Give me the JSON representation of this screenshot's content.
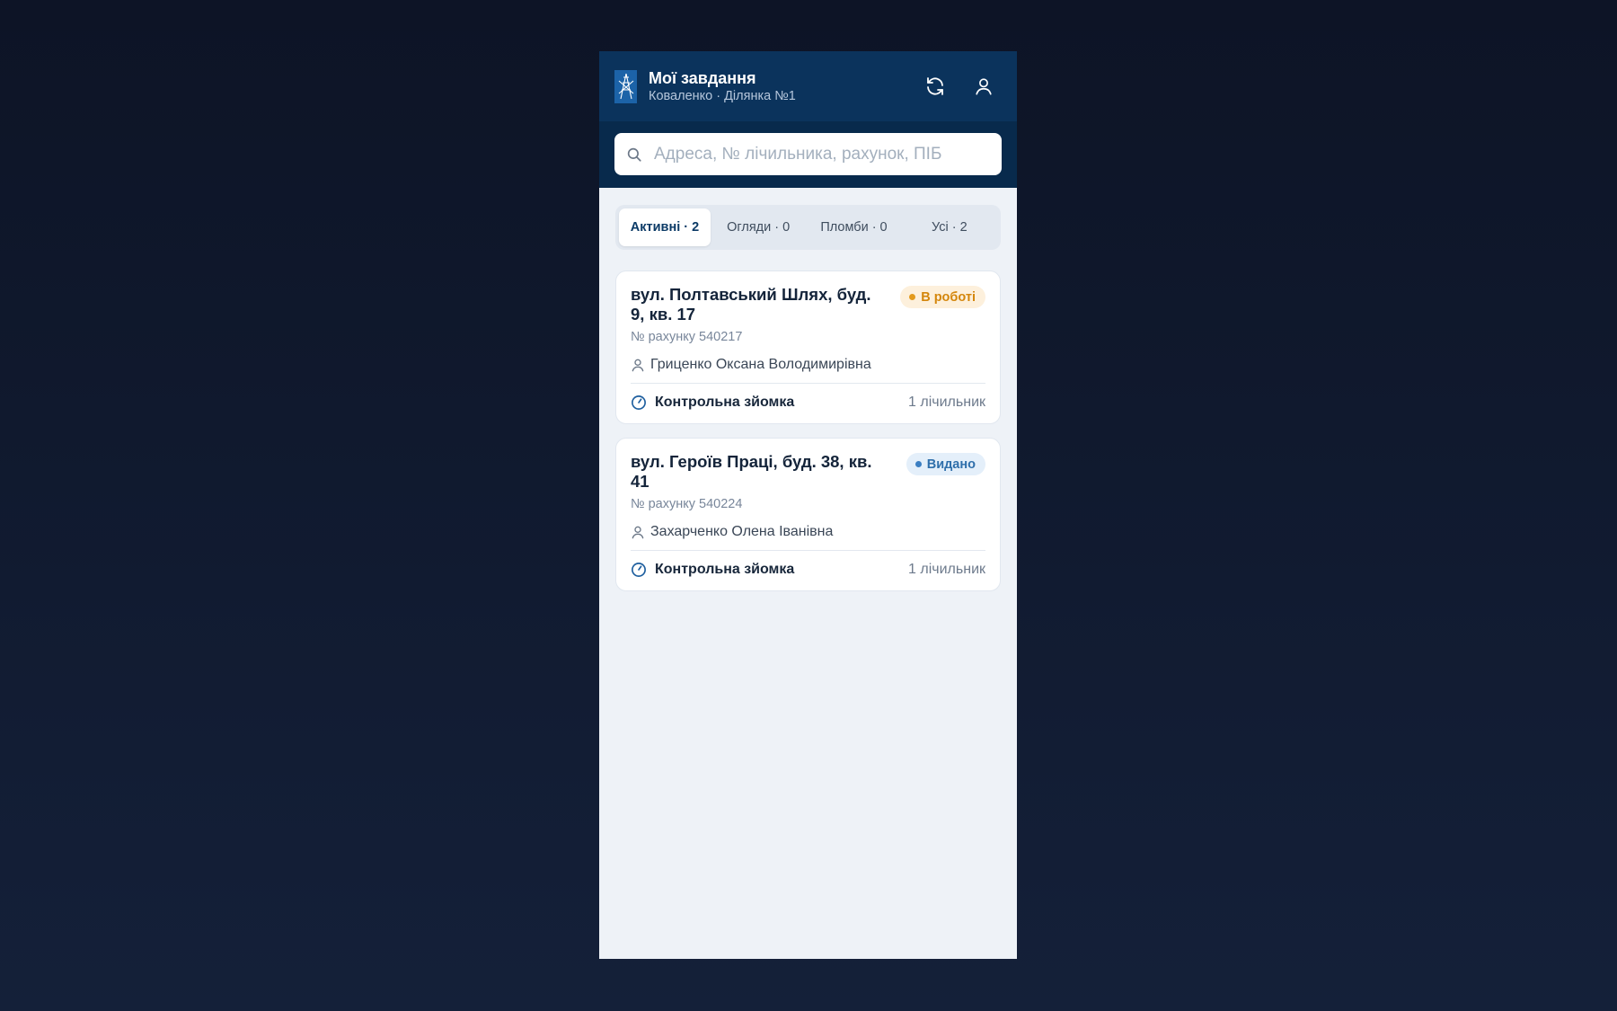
{
  "header": {
    "title": "Мої завдання",
    "subtitle": "Коваленко · Ділянка №1"
  },
  "search": {
    "placeholder": "Адреса, № лічильника, рахунок, ПІБ",
    "value": ""
  },
  "tabs": [
    {
      "label": "Активні · 2",
      "active": true
    },
    {
      "label": "Огляди · 0",
      "active": false
    },
    {
      "label": "Пломби · 0",
      "active": false
    },
    {
      "label": "Усі · 2",
      "active": false
    }
  ],
  "tasks": [
    {
      "address": "вул. Полтавський Шлях, буд. 9, кв. 17",
      "status": "В роботі",
      "status_color": "#d4860b",
      "account": "№ рахунку 540217",
      "person": "Гриценко Оксана Володимирівна",
      "task_type": "Контрольна зйомка",
      "meters": "1 лічильник"
    },
    {
      "address": "вул. Героїв Праці, буд. 38, кв. 41",
      "status": "Видано",
      "status_color": "#2f6fab",
      "account": "№ рахунку 540224",
      "person": "Захарченко Олена Іванівна",
      "task_type": "Контрольна зйомка",
      "meters": "1 лічильник"
    }
  ],
  "icons": {
    "logo": "power-tower-logo",
    "refresh": "refresh-icon",
    "profile": "user-icon",
    "search": "search-icon",
    "person": "person-icon",
    "task": "gauge-icon"
  },
  "colors": {
    "appbar": "#0b335c",
    "accent": "#0b3a66",
    "background": "#eef2f7"
  }
}
